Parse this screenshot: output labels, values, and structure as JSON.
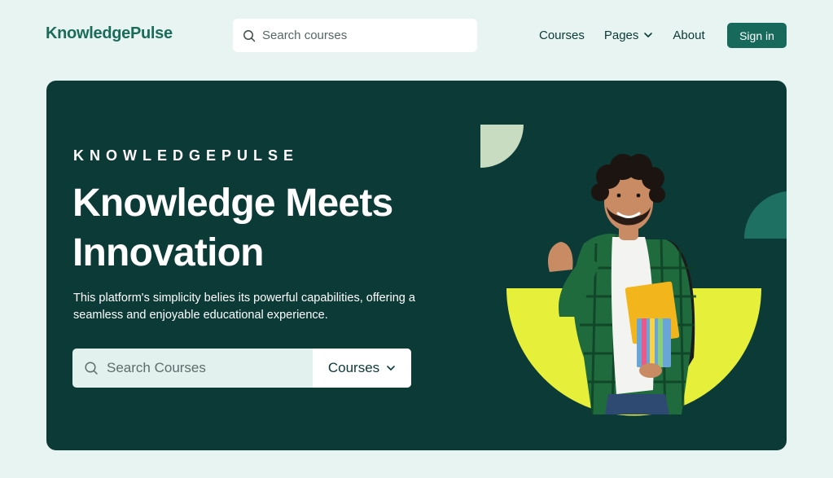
{
  "header": {
    "brand": "KnowledgePulse",
    "search": {
      "placeholder": "Search courses",
      "icon": "search-icon"
    },
    "nav": [
      {
        "label": "Courses"
      },
      {
        "label": "Pages",
        "icon": "chevron-down-icon"
      },
      {
        "label": "About"
      }
    ],
    "signin_label": "Sign in"
  },
  "hero": {
    "eyebrow": "KNOWLEDGEPULSE",
    "headline_line1": "Knowledge Meets",
    "headline_line2": "Innovation",
    "description": "This platform's simplicity belies its powerful capabilities, offering a seamless and enjoyable educational experience.",
    "search": {
      "placeholder": "Search Courses",
      "icon": "search-icon",
      "select_value": "Courses",
      "select_icon": "chevron-down-icon"
    },
    "illustration": "student-with-backpack-and-books"
  },
  "colors": {
    "page_background": "#e8f4f1",
    "hero_background": "#0b3a37",
    "brand_green": "#16695b",
    "accent_yellow": "#e6f03a",
    "accent_sage": "#c7dcc1",
    "accent_teal": "#1e7062"
  }
}
